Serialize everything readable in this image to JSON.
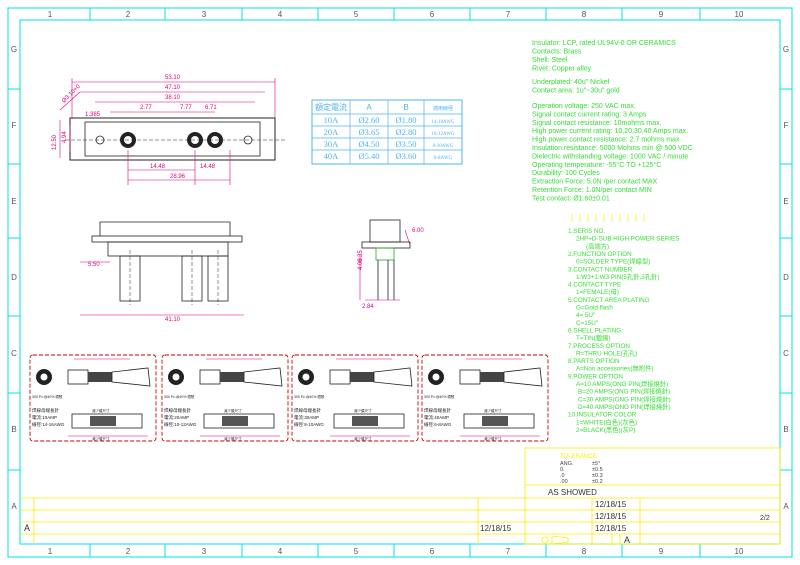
{
  "border": {
    "columns": [
      "1",
      "2",
      "3",
      "4",
      "5",
      "6",
      "7",
      "8",
      "9",
      "10"
    ],
    "rows": [
      "G",
      "F",
      "E",
      "D",
      "C",
      "B",
      "A"
    ]
  },
  "specs": {
    "lines_a": [
      "Insulator: LCP, rated UL94V-0 OR CERAMICS",
      "Contacts: Brass",
      "Shell: Steel",
      "Rivet: Copper alloy"
    ],
    "lines_b": [
      "Underplated: 40u\" Nickel",
      "Contact area: 1u\"~30u\" gold"
    ],
    "lines_c": [
      "Operation voltage: 250 VAC max.",
      "Signal contact current rating: 3 Amps",
      "Signal contact resistance: 10mohms max.",
      "High power current rating: 10,20,30,40 Amps max.",
      "High power contact resistance: 2.7 mohms max",
      "Insulation resistance: 5000 Mohms min @ 500 VDC",
      "Dielectric withstanding voltage: 1000 VAC / minute",
      "Operating temperature: -55°C TO +125°C",
      "Durability: 100 Cycles",
      "Extraction Force: 5.0N /per contact MAX",
      "Retention Force: 1.0N/per contact MIN",
      "Test contact: Ø1.60±0.01"
    ]
  },
  "series": {
    "lines": [
      "1.SERIS NO.",
      "2HP+D-SUB HIGH POWER SERIES",
      "(高端方)",
      "2.FUNCTION OPTION",
      "0=SOLDER TYPE(焊線型)",
      "3.CONTACT NUMBER",
      "1:W3+1:W3 PIN(5孔針,3孔針)",
      "4.CONTACT TYPE",
      "1=FEMALE(母)",
      "5.CONTACT AREA PLATING",
      "G=Gold flash",
      "4= 5U\"",
      "C=15U\"",
      "6.SHELL PLATING:",
      "T=TIN(鍍錫)",
      "7.PROCESS OPTION",
      "R=THRU HOLE(孔孔)",
      "8.PARTS OPTION",
      "A=Non accessories(無附件)",
      "9.POWER OPTION",
      "A=10 AMPS(ONG PIN(焊接燒針)",
      "B=20 AMPS(ONG PIN(焊接燒針)",
      "C=30 AMPS(ONG PIN(焊接燒針)",
      "D=40 AMPS(ONG PIN(焊接燒針)",
      "10.INSULATOR COLOR",
      "1=WHITE(白色)(灰色)",
      "2=BLACK(黑色)(灰P)"
    ]
  },
  "current_table": {
    "headers": [
      "額定電流",
      "A",
      "B",
      "適用線徑"
    ],
    "rows": [
      [
        "10A",
        "Ø2.60",
        "Ø1.80",
        "14-18AWG"
      ],
      [
        "20A",
        "Ø3.65",
        "Ø2.80",
        "10-12AWG"
      ],
      [
        "30A",
        "Ø4.50",
        "Ø3.50",
        "8-10AWG"
      ],
      [
        "40A",
        "Ø5.40",
        "Ø3.60",
        "6-8AWG"
      ]
    ]
  },
  "dims": {
    "top": [
      "53.10",
      "47.10",
      "38.10",
      "2.77",
      "7.77",
      "6.71",
      "1.385",
      "14.48",
      "14.48",
      "28.96",
      "12.50",
      "4.94",
      "Ø3.10+0"
    ],
    "side": [
      "5.50",
      "41.10",
      "6.00",
      "4.00",
      "6.35",
      "2.84"
    ]
  },
  "details": [
    {
      "note": "300 Pc.@40% 鐵殼",
      "label": "焊線母端長針",
      "current": "電流:10AMP",
      "wire": "線徑:14-16AWG",
      "dim": "減少護尺寸"
    },
    {
      "note": "300 Pc.@40% 鐵殼",
      "label": "焊線母端長針",
      "current": "電流:20AMP",
      "wire": "線徑:10-12AWG",
      "dim": "減少護尺寸"
    },
    {
      "note": "300 Pc.@40% 鐵殼",
      "label": "焊線母端長針",
      "current": "電流:30AMP",
      "wire": "線徑:8-10AWG",
      "dim": "減少護尺寸"
    },
    {
      "note": "300 Pc.@40% 鐵殼",
      "label": "焊線母端長針",
      "current": "電流:40AMP",
      "wire": "線徑:6-8AWG",
      "dim": "減少護尺寸"
    }
  ],
  "title_block": {
    "tol_title": "TOLERANCE",
    "tol_rows": [
      [
        "ANG.",
        "±5°"
      ],
      [
        "0.",
        "±0.5"
      ],
      [
        ".0",
        "±0.3"
      ],
      [
        ".00",
        "±0.2"
      ]
    ],
    "scale": "AS SHOWED",
    "dates": [
      "12/18/15",
      "12/18/15",
      "12/18/15"
    ],
    "left_date": "12/18/15",
    "sheet": "2/2",
    "rev": "A",
    "rev_left": "A"
  },
  "colors": {
    "frame": "#00e0e0",
    "specs": "#33dd33",
    "dim": "#e0007a",
    "table": "#4fb3f0",
    "detail": "#cc0000",
    "title": "#ffee00",
    "drawing": "#222222"
  }
}
